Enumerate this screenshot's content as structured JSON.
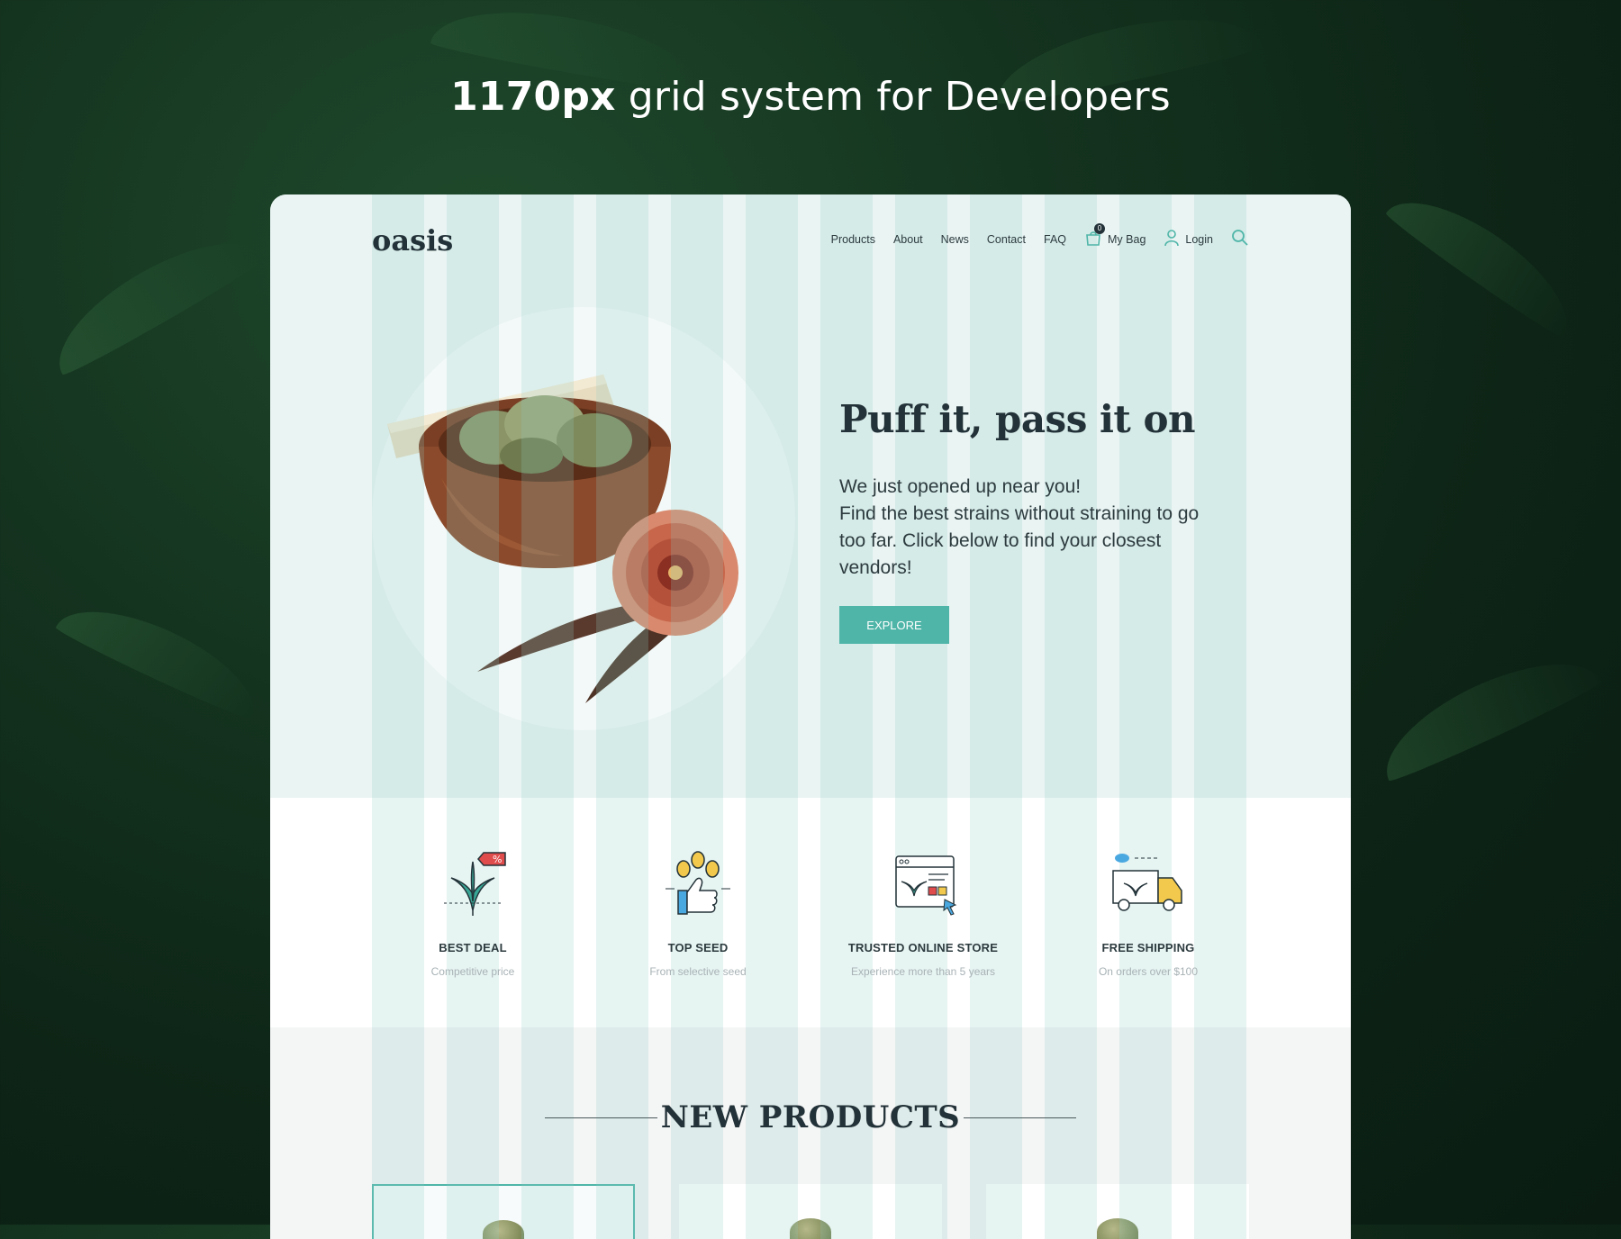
{
  "headline": {
    "bold": "1170px",
    "rest": " grid system for Developers"
  },
  "nav": {
    "logo": "oasis",
    "menu": [
      "Products",
      "About",
      "News",
      "Contact",
      "FAQ"
    ],
    "bag_label": "My Bag",
    "bag_count": "0",
    "login_label": "Login"
  },
  "hero": {
    "title": "Puff it, pass it on",
    "line1": "We just opened up near you!",
    "line2": "Find the best strains without straining to go",
    "line3": "too far. Click below to find your closest",
    "line4": "vendors!",
    "cta": "EXPLORE"
  },
  "features": [
    {
      "title": "BEST DEAL",
      "subtitle": "Competitive price",
      "icon": "leaf-tag-icon"
    },
    {
      "title": "TOP SEED",
      "subtitle": "From selective seed",
      "icon": "thumbs-up-seed-icon"
    },
    {
      "title": "TRUSTED ONLINE STORE",
      "subtitle": "Experience more than 5 years",
      "icon": "browser-store-icon"
    },
    {
      "title": "FREE SHIPPING",
      "subtitle": "On orders over $100",
      "icon": "delivery-truck-icon"
    }
  ],
  "products": {
    "section_title": "NEW PRODUCTS"
  },
  "colors": {
    "accent": "#4fb5a8",
    "dark": "#233238",
    "hero_bg": "#e9f4f3"
  }
}
